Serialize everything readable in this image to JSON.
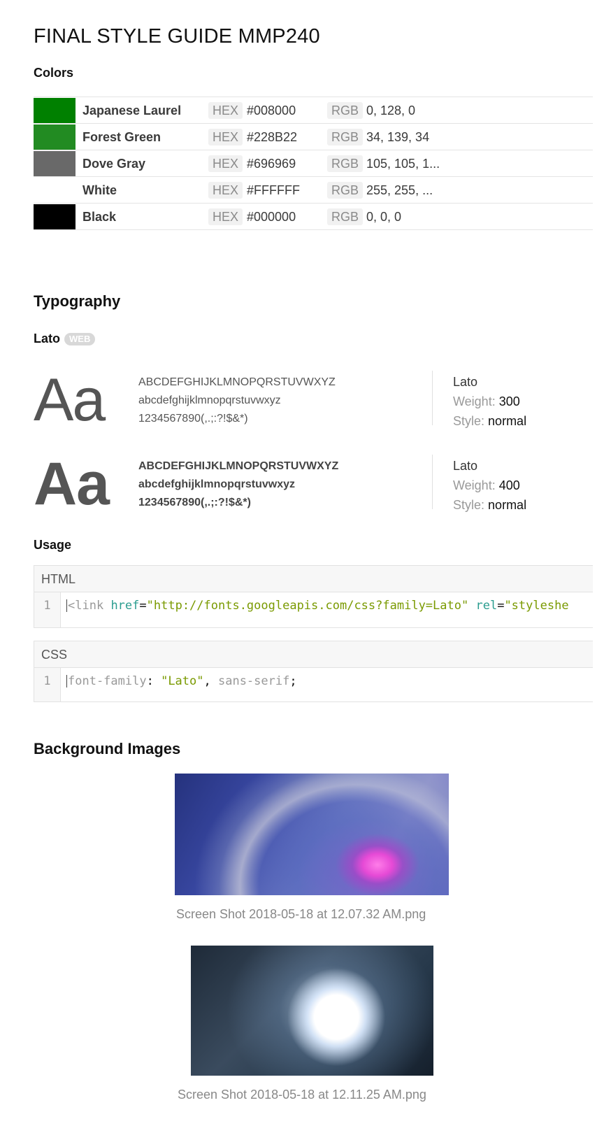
{
  "title": "FINAL STYLE GUIDE MMP240",
  "colors": {
    "heading": "Colors",
    "hex_label": "HEX",
    "rgb_label": "RGB",
    "items": [
      {
        "name": "Japanese Laurel",
        "hex": "#008000",
        "rgb": "0, 128, 0",
        "swatch": "#008000"
      },
      {
        "name": "Forest Green",
        "hex": "#228B22",
        "rgb": "34, 139, 34",
        "swatch": "#228B22"
      },
      {
        "name": "Dove Gray",
        "hex": "#696969",
        "rgb": "105, 105, 1...",
        "swatch": "#696969"
      },
      {
        "name": "White",
        "hex": "#FFFFFF",
        "rgb": "255, 255, ...",
        "swatch": "#FFFFFF"
      },
      {
        "name": "Black",
        "hex": "#000000",
        "rgb": "0, 0, 0",
        "swatch": "#000000"
      }
    ]
  },
  "typography": {
    "heading": "Typography",
    "font_name": "Lato",
    "font_badge": "WEB",
    "specimens": [
      {
        "sample": "Aa",
        "upper": "ABCDEFGHIJKLMNOPQRSTUVWXYZ",
        "lower": "abcdefghijklmnopqrstuvwxyz",
        "digits": "1234567890(,.;:?!$&*)",
        "family": "Lato",
        "weight_label": "Weight:",
        "weight": "300",
        "style_label": "Style:",
        "style": "normal"
      },
      {
        "sample": "Aa",
        "upper": "ABCDEFGHIJKLMNOPQRSTUVWXYZ",
        "lower": "abcdefghijklmnopqrstuvwxyz",
        "digits": "1234567890(,.;:?!$&*)",
        "family": "Lato",
        "weight_label": "Weight:",
        "weight": "400",
        "style_label": "Style:",
        "style": "normal"
      }
    ]
  },
  "usage": {
    "heading": "Usage",
    "html_block": {
      "label": "HTML",
      "line_no": "1",
      "tag_open": "<link",
      "attr1": "href",
      "eq1": "=",
      "val1": "\"http://fonts.googleapis.com/css?family=Lato\"",
      "attr2": "rel",
      "eq2": "=",
      "val2": "\"styleshe"
    },
    "css_block": {
      "label": "CSS",
      "line_no": "1",
      "prop": "font-family",
      "colon": ": ",
      "val1": "\"Lato\"",
      "comma": ", ",
      "val2": "sans-serif",
      "semi": ";"
    }
  },
  "background_images": {
    "heading": "Background Images",
    "images": [
      {
        "caption": "Screen Shot 2018-05-18 at 12.07.32 AM.png"
      },
      {
        "caption": "Screen Shot 2018-05-18 at 12.11.25 AM.png"
      }
    ]
  }
}
